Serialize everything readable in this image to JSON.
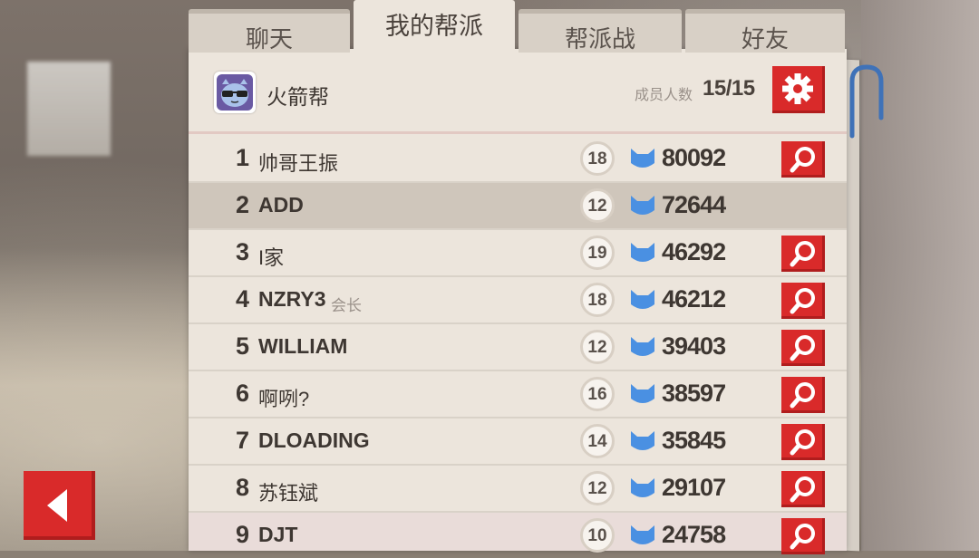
{
  "tabs": [
    {
      "label": "聊天"
    },
    {
      "label": "我的帮派"
    },
    {
      "label": "帮派战"
    },
    {
      "label": "好友"
    }
  ],
  "gang": {
    "name": "火箭帮",
    "member_label": "成员人数",
    "member_count": "15/15"
  },
  "members": [
    {
      "rank": "1",
      "name": "帅哥王振",
      "role": "",
      "level": "18",
      "score": "80092",
      "viewable": true
    },
    {
      "rank": "2",
      "name": "ADD",
      "role": "",
      "level": "12",
      "score": "72644",
      "viewable": false
    },
    {
      "rank": "3",
      "name": "I家",
      "role": "",
      "level": "19",
      "score": "46292",
      "viewable": true
    },
    {
      "rank": "4",
      "name": "NZRY3",
      "role": "会长",
      "level": "18",
      "score": "46212",
      "viewable": true
    },
    {
      "rank": "5",
      "name": "WILLIAM",
      "role": "",
      "level": "12",
      "score": "39403",
      "viewable": true
    },
    {
      "rank": "6",
      "name": "啊咧?",
      "role": "",
      "level": "16",
      "score": "38597",
      "viewable": true
    },
    {
      "rank": "7",
      "name": "DLOADING",
      "role": "",
      "level": "14",
      "score": "35845",
      "viewable": true
    },
    {
      "rank": "8",
      "name": "苏钰斌",
      "role": "",
      "level": "12",
      "score": "29107",
      "viewable": true
    },
    {
      "rank": "9",
      "name": "DJT",
      "role": "",
      "level": "10",
      "score": "24758",
      "viewable": true
    }
  ],
  "colors": {
    "accent_red": "#d92a2a",
    "score_icon_blue": "#4a90e2",
    "panel_bg": "#ece5dc",
    "selected_row_bg": "#cfc6bb"
  },
  "icons": {
    "settings": "gear-icon",
    "view": "magnifier-icon",
    "score": "cat-emblem-icon",
    "back": "back-arrow-icon",
    "avatar": "cat-sunglasses-icon"
  }
}
